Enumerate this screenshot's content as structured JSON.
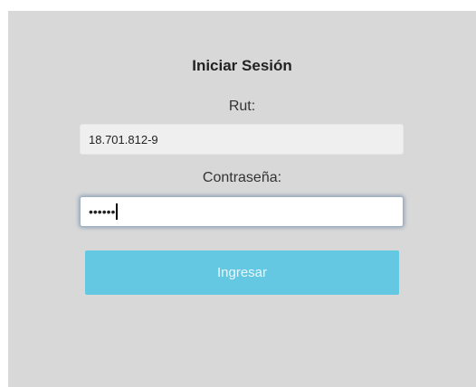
{
  "login": {
    "title": "Iniciar Sesión",
    "rut_label": "Rut:",
    "rut_value": "18.701.812-9",
    "password_label": "Contraseña:",
    "password_value": "••••••",
    "submit_label": "Ingresar"
  },
  "colors": {
    "panel_bg": "#d8d8d8",
    "button_bg": "#64c8e3",
    "button_text": "#e9f7fb",
    "focus_glow": "#5a7896"
  }
}
